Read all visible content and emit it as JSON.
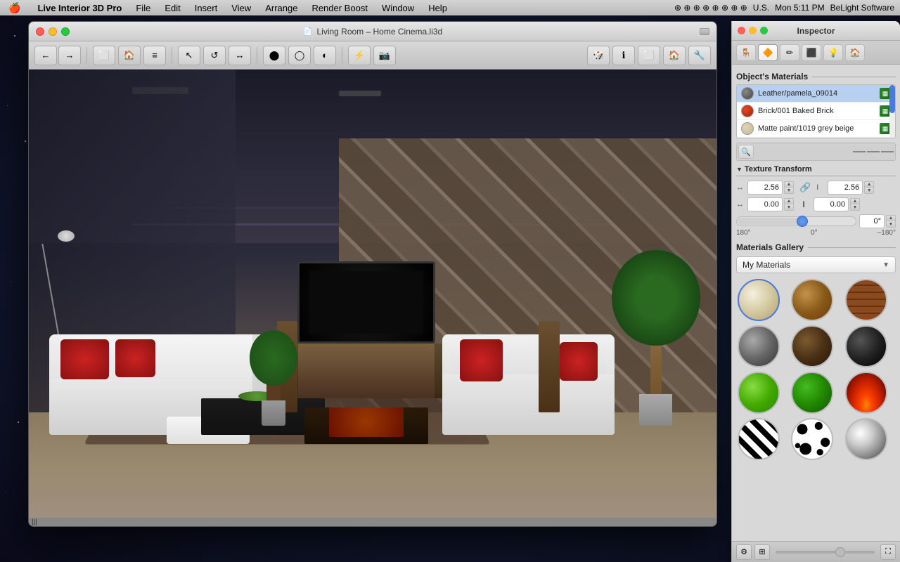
{
  "menubar": {
    "apple": "🍎",
    "items": [
      {
        "label": "Live Interior 3D Pro",
        "name": "app-name"
      },
      {
        "label": "File"
      },
      {
        "label": "Edit"
      },
      {
        "label": "Insert"
      },
      {
        "label": "View"
      },
      {
        "label": "Arrange"
      },
      {
        "label": "Render Boost"
      },
      {
        "label": "Window"
      },
      {
        "label": "Help"
      }
    ],
    "right_info": "U.S.",
    "time": "Mon 5:11 PM",
    "brand": "BeLight Software"
  },
  "window": {
    "title": "Living Room – Home Cinema.li3d",
    "traffic_lights": [
      "red",
      "yellow",
      "green"
    ]
  },
  "inspector": {
    "title": "Inspector",
    "section_materials": "Object's Materials",
    "materials": [
      {
        "name": "Leather/pamela_09014",
        "color": "#5a5a5a",
        "type": "texture"
      },
      {
        "name": "Brick/001 Baked Brick",
        "color": "#cc3322",
        "type": "texture"
      },
      {
        "name": "Matte paint/1019 grey beige",
        "color": "#d4c8b0",
        "type": "texture"
      }
    ],
    "texture_transform": {
      "title": "Texture Transform",
      "width_value": "2.56",
      "height_value": "2.56",
      "offset_x": "0.00",
      "offset_y": "0.00",
      "angle_value": "0°",
      "angle_min": "180°",
      "angle_mid": "0°",
      "angle_max": "–180°"
    },
    "gallery": {
      "title": "Materials Gallery",
      "dropdown_label": "My Materials",
      "spheres": [
        {
          "id": "ivory",
          "class": "sphere-ivory"
        },
        {
          "id": "wood",
          "class": "sphere-wood"
        },
        {
          "id": "brick-tex",
          "class": "sphere-brick"
        },
        {
          "id": "metal",
          "class": "sphere-metal"
        },
        {
          "id": "dark-wood",
          "class": "sphere-dark-wood"
        },
        {
          "id": "black",
          "class": "sphere-black"
        },
        {
          "id": "green-bright",
          "class": "sphere-green-bright"
        },
        {
          "id": "green-dark",
          "class": "sphere-green-dark"
        },
        {
          "id": "fire",
          "class": "sphere-fire"
        },
        {
          "id": "zebra",
          "class": "sphere-zebra"
        },
        {
          "id": "spots",
          "class": "sphere-spots"
        },
        {
          "id": "chrome",
          "class": "sphere-chrome"
        }
      ]
    }
  },
  "tabs": [
    {
      "id": "furniture",
      "icon": "🪑"
    },
    {
      "id": "material",
      "icon": "🔶"
    },
    {
      "id": "edit",
      "icon": "✏️"
    },
    {
      "id": "render",
      "icon": "⬛"
    },
    {
      "id": "light",
      "icon": "💡"
    },
    {
      "id": "scene",
      "icon": "🏠"
    }
  ],
  "toolbar": {
    "nav_back": "←",
    "nav_forward": "→",
    "tools": [
      "⬜",
      "📐",
      "↔",
      "⬤",
      "◯",
      "◐"
    ],
    "special": [
      "⚡",
      "📷"
    ],
    "right": [
      "🎲",
      "ℹ",
      "⬜",
      "🏠",
      "🔧"
    ]
  }
}
